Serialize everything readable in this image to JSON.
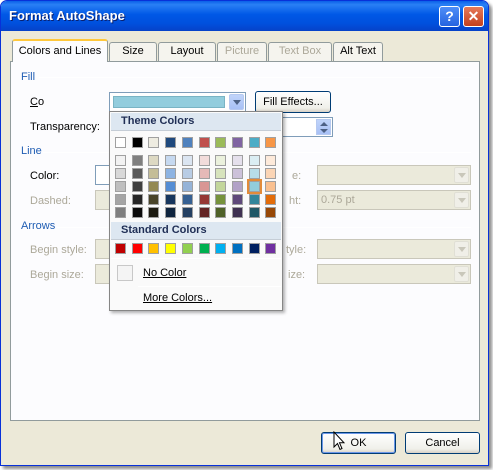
{
  "window": {
    "title": "Format AutoShape",
    "help_glyph": "?",
    "close_glyph": "✕"
  },
  "tabs": [
    {
      "label": "Colors and Lines",
      "state": "active"
    },
    {
      "label": "Size",
      "state": "normal"
    },
    {
      "label": "Layout",
      "state": "normal"
    },
    {
      "label": "Picture",
      "state": "disabled"
    },
    {
      "label": "Text Box",
      "state": "disabled"
    },
    {
      "label": "Alt Text",
      "state": "normal"
    }
  ],
  "fill": {
    "section_label": "Fill",
    "color_label": "Color:",
    "transparency_label": "Transparency:",
    "fill_effects_label": "Fill Effects...",
    "current_color": "#93cddd"
  },
  "line": {
    "section_label": "Line",
    "color_label": "Color:",
    "dashed_label": "Dashed:",
    "weight_label_visible": "ht:",
    "style_label_visible": "e:",
    "weight_value": "0.75 pt"
  },
  "arrows": {
    "section_label": "Arrows",
    "begin_style_label": "Begin style:",
    "begin_size_label": "Begin size:",
    "end_style_label_visible": "tyle:",
    "end_size_label_visible": "ize:"
  },
  "popup": {
    "theme_header": "Theme Colors",
    "standard_header": "Standard Colors",
    "no_color_label": "No Color",
    "more_colors_label": "More Colors...",
    "theme_top": [
      "#ffffff",
      "#000000",
      "#eeece1",
      "#1f497d",
      "#4f81bd",
      "#c0504d",
      "#9bbb59",
      "#8064a2",
      "#4bacc6",
      "#f79646"
    ],
    "theme_shades": [
      [
        "#f2f2f2",
        "#d8d8d8",
        "#bfbfbf",
        "#a5a5a5",
        "#7f7f7f"
      ],
      [
        "#7f7f7f",
        "#595959",
        "#3f3f3f",
        "#262626",
        "#0c0c0c"
      ],
      [
        "#ddd9c3",
        "#c4bd97",
        "#938953",
        "#494429",
        "#1d1b10"
      ],
      [
        "#c6d9f0",
        "#8db3e2",
        "#548dd4",
        "#17365d",
        "#0f243e"
      ],
      [
        "#dbe5f1",
        "#b8cce4",
        "#95b3d7",
        "#366092",
        "#244061"
      ],
      [
        "#f2dcdb",
        "#e5b9b7",
        "#d99694",
        "#953734",
        "#632423"
      ],
      [
        "#ebf1dd",
        "#d7e3bc",
        "#c3d69b",
        "#76923c",
        "#4f6128"
      ],
      [
        "#e5e0ec",
        "#ccc1d9",
        "#b2a2c7",
        "#5f497a",
        "#3f3151"
      ],
      [
        "#dbeef3",
        "#b7dde8",
        "#92cddc",
        "#31859b",
        "#205867"
      ],
      [
        "#fdeada",
        "#fbd5b5",
        "#fac08f",
        "#e36c09",
        "#974806"
      ]
    ],
    "selected_shade": {
      "col": 8,
      "row": 2
    },
    "standard": [
      "#c00000",
      "#ff0000",
      "#ffc000",
      "#ffff00",
      "#92d050",
      "#00b050",
      "#00b0f0",
      "#0070c0",
      "#002060",
      "#7030a0"
    ]
  },
  "buttons": {
    "ok_label": "OK",
    "cancel_label": "Cancel"
  }
}
